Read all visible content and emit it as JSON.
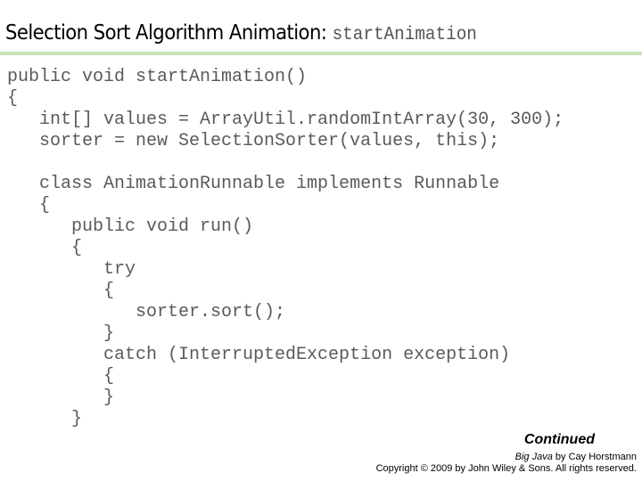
{
  "header": {
    "title": "Selection Sort Algorithm Animation:",
    "title_code": "startAnimation",
    "rule_color": "#c6e2b6"
  },
  "code": {
    "lines": [
      "public void startAnimation()",
      "{",
      "   int[] values = ArrayUtil.randomIntArray(30, 300);",
      "   sorter = new SelectionSorter(values, this);",
      "",
      "   class AnimationRunnable implements Runnable",
      "   {",
      "      public void run()",
      "      {",
      "         try",
      "         {",
      "            sorter.sort();",
      "         }",
      "         catch (InterruptedException exception)",
      "         {",
      "         }",
      "      }"
    ]
  },
  "footer": {
    "continued": "Continued",
    "book_title": "Big Java",
    "book_author": " by Cay Horstmann",
    "copyright": "Copyright © 2009 by John Wiley & Sons.  All rights reserved."
  }
}
